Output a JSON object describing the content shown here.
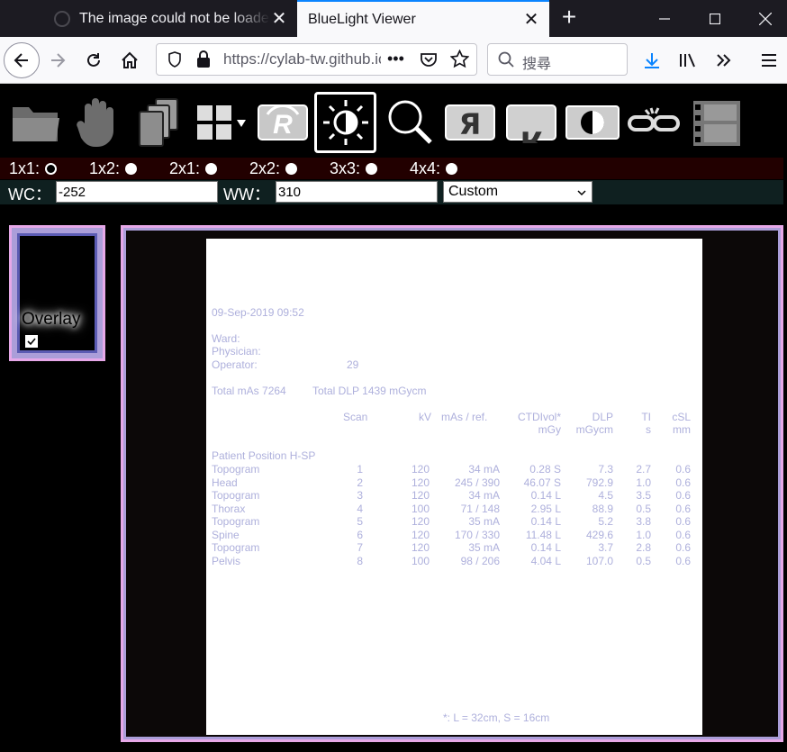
{
  "browser": {
    "tabs": [
      {
        "title": "The image could not be loaded"
      },
      {
        "title": "BlueLight Viewer"
      }
    ],
    "url": "https://cylab-tw.github.io/bluelight",
    "search_placeholder": "搜尋"
  },
  "toolbar": {
    "tools": [
      "open-folder",
      "pan-hand",
      "series-stack",
      "layout-grid",
      "rotate",
      "window-level",
      "zoom",
      "flip-horizontal",
      "flip-vertical",
      "invert",
      "link",
      "film"
    ],
    "selected_tool": "window-level"
  },
  "layout": {
    "options": [
      {
        "label": "1x1:",
        "selected": true
      },
      {
        "label": "1x2:",
        "selected": false
      },
      {
        "label": "2x1:",
        "selected": false
      },
      {
        "label": "2x2:",
        "selected": false
      },
      {
        "label": "3x3:",
        "selected": false
      },
      {
        "label": "4x4:",
        "selected": false
      }
    ]
  },
  "window": {
    "wc_label": "WC：",
    "wc_value": "-252",
    "ww_label": "WW：",
    "ww_value": "310",
    "preset": "Custom"
  },
  "thumbnail": {
    "overlay_label": "Overlay",
    "overlay_checked": true
  },
  "report": {
    "datetime": "09-Sep-2019  09:52",
    "ward_label": "Ward:",
    "physician_label": "Physician:",
    "operator_label": "Operator:",
    "operator_value": "29",
    "total_mas": "Total mAs 7264",
    "total_dlp": "Total DLP 1439 mGycm",
    "headers": {
      "scan": "Scan",
      "kv": "kV",
      "mas_ref": "mAs  / ref.",
      "ctdi": "CTDIvol*",
      "ctdi_unit": "mGy",
      "dlp": "DLP",
      "dlp_unit": "mGycm",
      "ti": "TI",
      "ti_unit": "s",
      "csl": "cSL",
      "csl_unit": "mm"
    },
    "position": "Patient Position H-SP",
    "rows": [
      {
        "name": "Topogram",
        "scan": "1",
        "kv": "120",
        "mas": "34 mA",
        "ctdi": "0.28 S",
        "dlp": "7.3",
        "ti": "2.7",
        "csl": "0.6"
      },
      {
        "name": "Head",
        "scan": "2",
        "kv": "120",
        "mas": "245  / 390",
        "ctdi": "46.07 S",
        "dlp": "792.9",
        "ti": "1.0",
        "csl": "0.6"
      },
      {
        "name": "Topogram",
        "scan": "3",
        "kv": "120",
        "mas": "34 mA",
        "ctdi": "0.14 L",
        "dlp": "4.5",
        "ti": "3.5",
        "csl": "0.6"
      },
      {
        "name": "Thorax",
        "scan": "4",
        "kv": "100",
        "mas": "71  / 148",
        "ctdi": "2.95 L",
        "dlp": "88.9",
        "ti": "0.5",
        "csl": "0.6"
      },
      {
        "name": "Topogram",
        "scan": "5",
        "kv": "120",
        "mas": "35 mA",
        "ctdi": "0.14 L",
        "dlp": "5.2",
        "ti": "3.8",
        "csl": "0.6"
      },
      {
        "name": "Spine",
        "scan": "6",
        "kv": "120",
        "mas": "170  / 330",
        "ctdi": "11.48 L",
        "dlp": "429.6",
        "ti": "1.0",
        "csl": "0.6"
      },
      {
        "name": "Topogram",
        "scan": "7",
        "kv": "120",
        "mas": "35 mA",
        "ctdi": "0.14 L",
        "dlp": "3.7",
        "ti": "2.8",
        "csl": "0.6"
      },
      {
        "name": "Pelvis",
        "scan": "8",
        "kv": "100",
        "mas": "98  / 206",
        "ctdi": "4.04 L",
        "dlp": "107.0",
        "ti": "0.5",
        "csl": "0.6"
      }
    ],
    "footnote": "*: L = 32cm, S = 16cm"
  }
}
